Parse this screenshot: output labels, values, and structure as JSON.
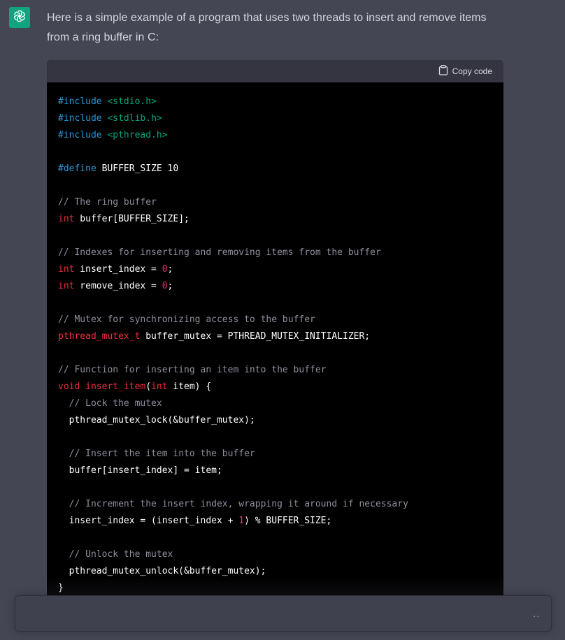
{
  "message": {
    "text": "Here is a simple example of a program that uses two threads to insert and remove items from a ring buffer in C:"
  },
  "code_block": {
    "copy_label": "Copy code",
    "lines": [
      [
        [
          "kw",
          "#include "
        ],
        [
          "str",
          "<stdio.h>"
        ]
      ],
      [
        [
          "kw",
          "#include "
        ],
        [
          "str",
          "<stdlib.h>"
        ]
      ],
      [
        [
          "kw",
          "#include "
        ],
        [
          "str",
          "<pthread.h>"
        ]
      ],
      [],
      [
        [
          "kw",
          "#define "
        ],
        [
          "p",
          "BUFFER_SIZE 10"
        ]
      ],
      [],
      [
        [
          "cm",
          "// The ring buffer"
        ]
      ],
      [
        [
          "ty",
          "int"
        ],
        [
          "p",
          " buffer[BUFFER_SIZE];"
        ]
      ],
      [],
      [
        [
          "cm",
          "// Indexes for inserting and removing items from the buffer"
        ]
      ],
      [
        [
          "ty",
          "int"
        ],
        [
          "p",
          " insert_index = "
        ],
        [
          "num",
          "0"
        ],
        [
          "p",
          ";"
        ]
      ],
      [
        [
          "ty",
          "int"
        ],
        [
          "p",
          " remove_index = "
        ],
        [
          "num",
          "0"
        ],
        [
          "p",
          ";"
        ]
      ],
      [],
      [
        [
          "cm",
          "// Mutex for synchronizing access to the buffer"
        ]
      ],
      [
        [
          "ty",
          "pthread_mutex_t"
        ],
        [
          "p",
          " buffer_mutex = PTHREAD_MUTEX_INITIALIZER;"
        ]
      ],
      [],
      [
        [
          "cm",
          "// Function for inserting an item into the buffer"
        ]
      ],
      [
        [
          "ty",
          "void"
        ],
        [
          "p",
          " "
        ],
        [
          "fn",
          "insert_item"
        ],
        [
          "p",
          "("
        ],
        [
          "ty",
          "int"
        ],
        [
          "p",
          " item) {"
        ]
      ],
      [
        [
          "p",
          "  "
        ],
        [
          "cm",
          "// Lock the mutex"
        ]
      ],
      [
        [
          "p",
          "  pthread_mutex_lock(&buffer_mutex);"
        ]
      ],
      [],
      [
        [
          "p",
          "  "
        ],
        [
          "cm",
          "// Insert the item into the buffer"
        ]
      ],
      [
        [
          "p",
          "  buffer[insert_index] = item;"
        ]
      ],
      [],
      [
        [
          "p",
          "  "
        ],
        [
          "cm",
          "// Increment the insert index, wrapping it around if necessary"
        ]
      ],
      [
        [
          "p",
          "  insert_index = (insert_index + "
        ],
        [
          "num",
          "1"
        ],
        [
          "p",
          ") % BUFFER_SIZE;"
        ]
      ],
      [],
      [
        [
          "p",
          "  "
        ],
        [
          "cm",
          "// Unlock the mutex"
        ]
      ],
      [
        [
          "p",
          "  pthread_mutex_unlock(&buffer_mutex);"
        ]
      ],
      [
        [
          "p",
          "}"
        ]
      ]
    ]
  },
  "input": {
    "value": "",
    "placeholder": "",
    "dots": ".."
  },
  "icons": {
    "avatar": "openai-logo-icon",
    "copy": "clipboard-icon"
  },
  "colors": {
    "page_bg": "#444654",
    "avatar_bg": "#10a37f",
    "code_bg": "#000000",
    "code_header_bg": "#343541",
    "keyword": "#2e95d3",
    "string": "#00a67d",
    "comment": "#8e8ea0",
    "type": "#f22c3d",
    "number": "#df3079"
  }
}
